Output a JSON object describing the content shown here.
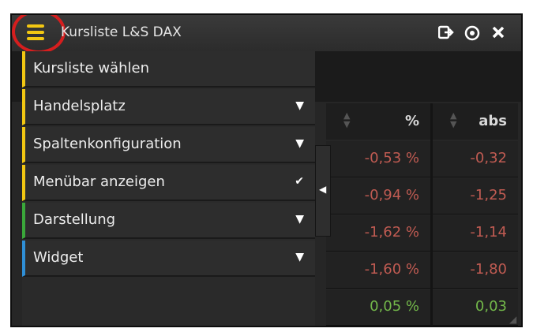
{
  "window": {
    "title": "Kursliste L&S DAX",
    "icons": [
      "popout-icon",
      "settings-icon",
      "close-icon"
    ]
  },
  "columns": [
    {
      "label": "%",
      "sort_icon": "sort-icon"
    },
    {
      "label": "abs",
      "sort_icon": "sort-icon"
    }
  ],
  "rows": [
    {
      "pct": "-0,53 %",
      "abs": "-0,32",
      "trend": "negative"
    },
    {
      "pct": "-0,94 %",
      "abs": "-1,25",
      "trend": "negative"
    },
    {
      "pct": "-1,62 %",
      "abs": "-1,14",
      "trend": "negative"
    },
    {
      "pct": "-1,60 %",
      "abs": "-1,80",
      "trend": "negative"
    },
    {
      "pct": "0,05 %",
      "abs": "0,03",
      "trend": "positive"
    }
  ],
  "menu": {
    "items": [
      {
        "label": "Kursliste wählen",
        "indicator": "",
        "accent": "#f2c712"
      },
      {
        "label": "Handelsplatz",
        "indicator": "▼",
        "accent": "#f2c712"
      },
      {
        "label": "Spaltenkonfiguration",
        "indicator": "▼",
        "accent": "#f2c712"
      },
      {
        "label": "Menübar anzeigen",
        "indicator": "✔",
        "accent": "#f2c712"
      },
      {
        "label": "Darstellung",
        "indicator": "▼",
        "accent": "#3aa83a"
      },
      {
        "label": "Widget",
        "indicator": "▼",
        "accent": "#2f8fd6"
      }
    ]
  },
  "colors": {
    "negative": "#c05b52",
    "positive": "#73b84a",
    "menu_icon": "#f2c712",
    "highlight_ring": "#d61e1e"
  }
}
